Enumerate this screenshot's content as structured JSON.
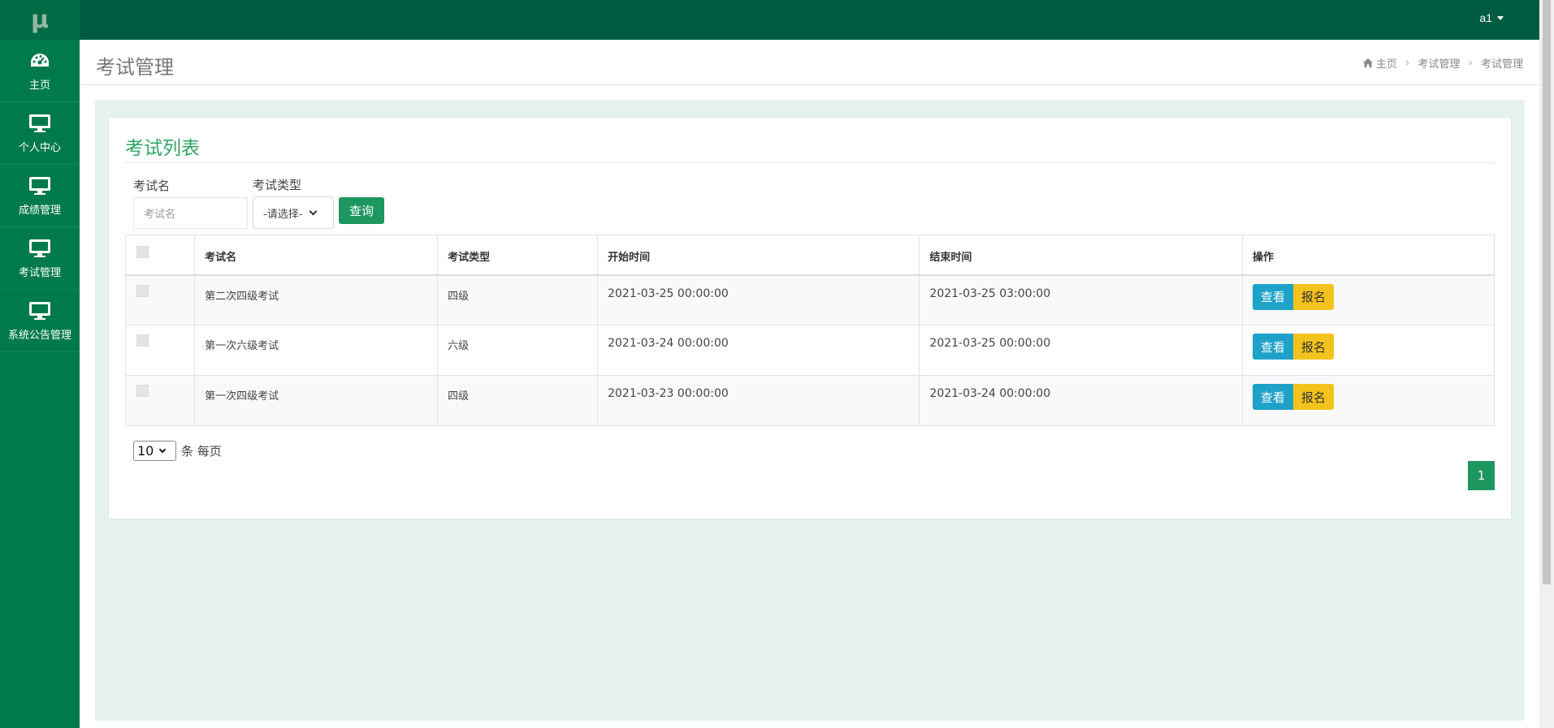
{
  "app": {
    "logo": "μ"
  },
  "topbar": {
    "username": "a1"
  },
  "sidebar": {
    "items": [
      {
        "label": "主页",
        "icon": "dashboard-icon"
      },
      {
        "label": "个人中心",
        "icon": "monitor-icon"
      },
      {
        "label": "成绩管理",
        "icon": "monitor-icon"
      },
      {
        "label": "考试管理",
        "icon": "monitor-icon"
      },
      {
        "label": "系统公告管理",
        "icon": "monitor-icon"
      }
    ]
  },
  "header": {
    "title": "考试管理",
    "breadcrumb": [
      "主页",
      "考试管理",
      "考试管理"
    ]
  },
  "card": {
    "title": "考试列表"
  },
  "filter": {
    "name_label": "考试名",
    "name_placeholder": "考试名",
    "type_label": "考试类型",
    "type_selected": "-请选择-",
    "query_label": "查询"
  },
  "table": {
    "headers": [
      "",
      "考试名",
      "考试类型",
      "开始时间",
      "结束时间",
      "操作"
    ],
    "rows": [
      {
        "name": "第二次四级考试",
        "type": "四级",
        "start": "2021-03-25 00:00:00",
        "end": "2021-03-25 03:00:00"
      },
      {
        "name": "第一次六级考试",
        "type": "六级",
        "start": "2021-03-24 00:00:00",
        "end": "2021-03-25 00:00:00"
      },
      {
        "name": "第一次四级考试",
        "type": "四级",
        "start": "2021-03-23 00:00:00",
        "end": "2021-03-24 00:00:00"
      }
    ],
    "view_label": "查看",
    "enroll_label": "报名"
  },
  "pagination": {
    "page_size": "10",
    "page_size_suffix": "条 每页",
    "current_page": "1"
  },
  "colors": {
    "topbar": "#005c40",
    "sidebar": "#007a4c",
    "accent": "#1e9660",
    "view_button": "#1ea2c8",
    "enroll_button": "#f4c21c"
  }
}
